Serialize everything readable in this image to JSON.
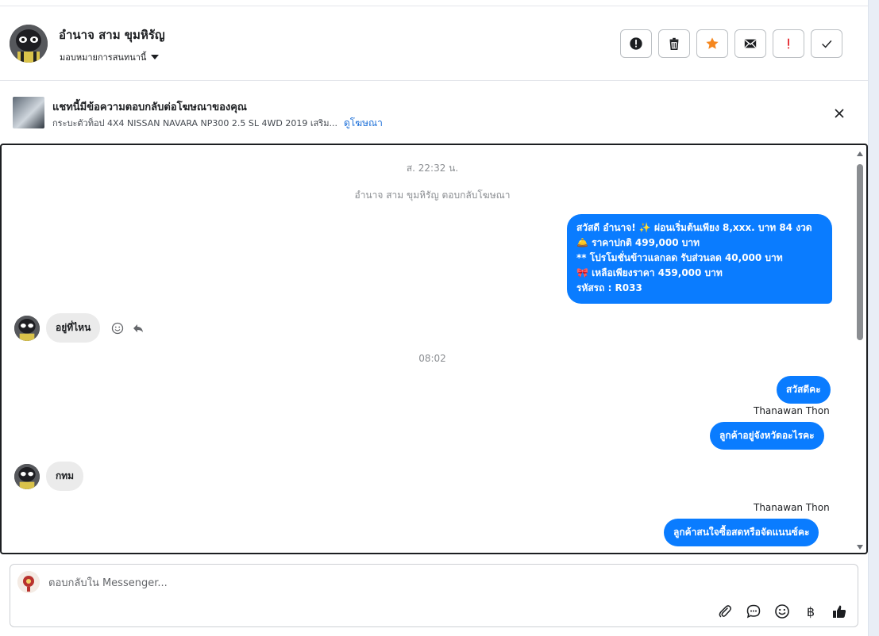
{
  "header": {
    "contact_name": "อำนาจ สาม ขุมหิรัญ",
    "assign_label": "มอบหมายการสนทนานี้",
    "actions": [
      {
        "name": "alert-circle",
        "color": "#1c1e21"
      },
      {
        "name": "trash",
        "color": "#1c1e21"
      },
      {
        "name": "star",
        "color": "#f5871f"
      },
      {
        "name": "envelope",
        "color": "#1c1e21"
      },
      {
        "name": "exclamation",
        "color": "#e4222a"
      },
      {
        "name": "check",
        "color": "#1c1e21"
      }
    ]
  },
  "ad_banner": {
    "title": "แชทนี้มีข้อความตอบกลับต่อโฆษณาของคุณ",
    "description": "กระบะตัวท็อป 4X4 NISSAN NAVARA NP300 2.5 SL 4WD 2019 เสริม...",
    "link_label": "ดูโฆษณา",
    "close_icon": "close-icon"
  },
  "chat": {
    "timestamp_1": "ส. 22:32 น.",
    "system_message": "อำนาจ สาม ขุมหิรัญ ตอบกลับโฆษณา",
    "promo_lines": [
      "สวัสดี อำนาจ! ✨  ผ่อนเริ่มต้นเพียง 8,xxx. บาท 84 งวด",
      "🛎️ ราคาปกติ 499,000 บาท",
      "** โปรโมชั่นข้าวแลกลด รับส่วนลด 40,000 บาท",
      "🎀  เหลือเพียงราคา 459,000 บาท",
      " รหัสรถ : R033"
    ],
    "incoming_1": "อยู่ที่ไหน",
    "timestamp_2": "08:02",
    "outgoing_1": "สวัสดีคะ",
    "sender_1": "Thanawan Thon",
    "outgoing_2": "ลูกค้าอยู่จังหวัดอะไรคะ",
    "incoming_2": "กทม",
    "sender_2": "Thanawan Thon",
    "outgoing_3": "ลูกค้าสนใจซื้อสดหรือจัดแนนซ์คะ"
  },
  "composer": {
    "placeholder": "ตอบกลับใน Messenger...",
    "tools": [
      "paperclip-icon",
      "chat-bubble-icon",
      "smiley-icon",
      "baht-icon",
      "thumbs-up-icon"
    ],
    "baht_symbol": "฿"
  },
  "colors": {
    "accent": "#0a7cff",
    "incoming_bubble": "#ebebeb",
    "star": "#f5871f",
    "exclamation": "#e4222a"
  }
}
